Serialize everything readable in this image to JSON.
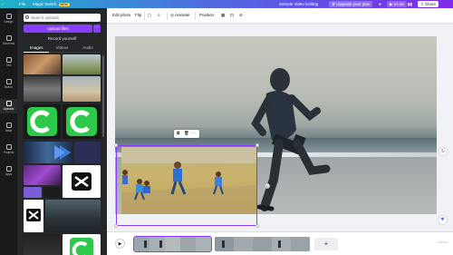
{
  "topbar": {
    "file": "File",
    "magic_switch": "Magic Switch",
    "new_badge": "NEW",
    "doc_title": "Sample Video Editing",
    "upgrade": "Upgrade your plan",
    "duration": "21.8s",
    "share": "Share"
  },
  "rail": [
    {
      "label": "Design",
      "icon": "design-icon"
    },
    {
      "label": "Elements",
      "icon": "elements-icon"
    },
    {
      "label": "Text",
      "icon": "text-icon"
    },
    {
      "label": "Brand",
      "icon": "brand-icon"
    },
    {
      "label": "Uploads",
      "icon": "upload-icon",
      "active": true
    },
    {
      "label": "Draw",
      "icon": "draw-icon"
    },
    {
      "label": "Projects",
      "icon": "folder-icon"
    },
    {
      "label": "Apps",
      "icon": "apps-icon"
    }
  ],
  "panel": {
    "search_placeholder": "Search uploads",
    "upload_button": "Upload files",
    "upload_more": "···",
    "record": "Record yourself",
    "tabs": [
      "Images",
      "Videos",
      "Audio"
    ],
    "active_tab": "Images"
  },
  "editbar": {
    "edit_photo": "Edit photo",
    "flip": "Flip",
    "animate": "Animate",
    "position": "Position"
  },
  "floating_toolbar": {
    "copy": "⧉",
    "delete": "🗑",
    "more": "···"
  },
  "timeline": {
    "play": "▶",
    "add": "+",
    "watermark": "Canva"
  },
  "colors": {
    "accent": "#8b3dff",
    "panel": "#252627",
    "rail": "#18191b"
  }
}
